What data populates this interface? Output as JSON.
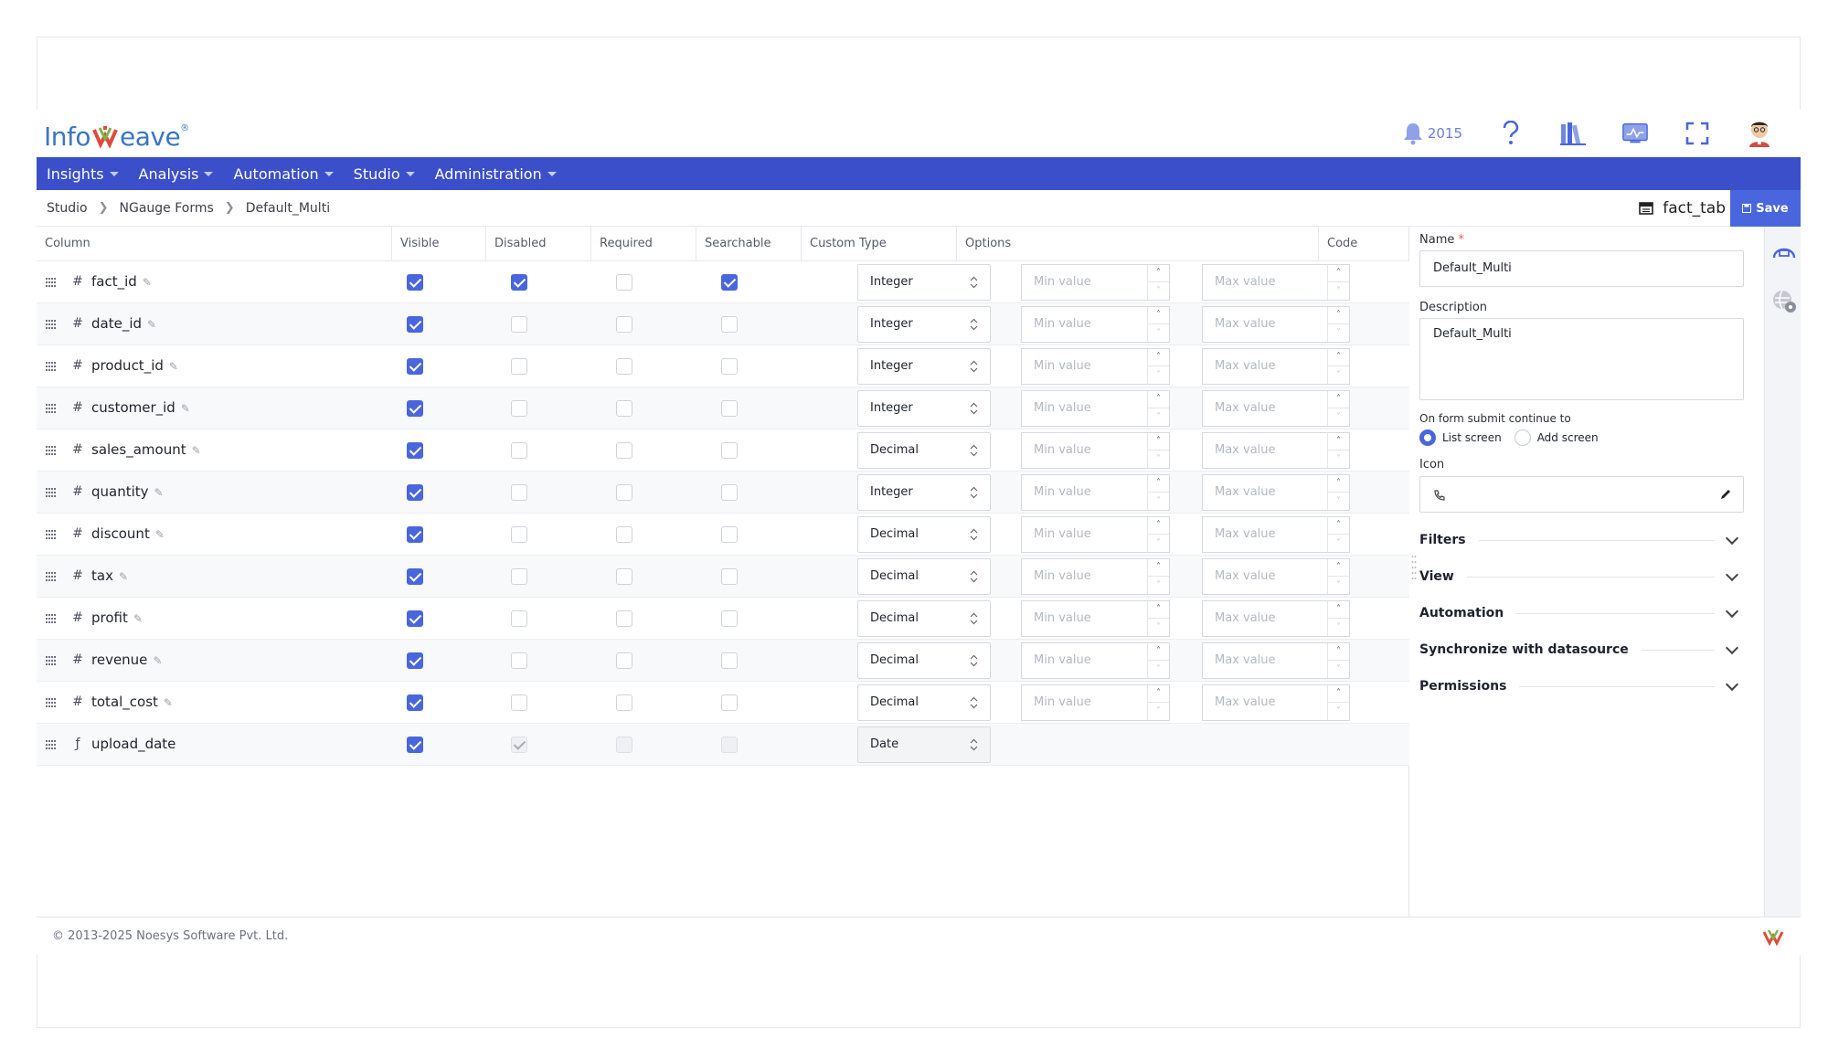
{
  "app": {
    "logo_left": "Info",
    "logo_right": "eave",
    "logo_reg": "®"
  },
  "header": {
    "notification_count": "2015"
  },
  "nav": {
    "items": [
      {
        "label": "Insights"
      },
      {
        "label": "Analysis"
      },
      {
        "label": "Automation"
      },
      {
        "label": "Studio"
      },
      {
        "label": "Administration"
      }
    ]
  },
  "breadcrumb": [
    "Studio",
    "NGauge Forms",
    "Default_Multi"
  ],
  "toolbar": {
    "table_name": "fact_tab",
    "save_label": "Save"
  },
  "grid": {
    "headers": {
      "column": "Column",
      "visible": "Visible",
      "disabled": "Disabled",
      "required": "Required",
      "searchable": "Searchable",
      "custom_type": "Custom Type",
      "options": "Options",
      "code": "Code"
    },
    "min_placeholder": "Min value",
    "max_placeholder": "Max value",
    "rows": [
      {
        "name": "fact_id",
        "type_icon": "hash-icon",
        "visible": true,
        "disabled": true,
        "required": false,
        "searchable": true,
        "custom_type": "Integer",
        "options": true,
        "editable": true,
        "locked": false
      },
      {
        "name": "date_id",
        "type_icon": "hash-icon",
        "visible": true,
        "disabled": false,
        "required": false,
        "searchable": false,
        "custom_type": "Integer",
        "options": true,
        "editable": true,
        "locked": false
      },
      {
        "name": "product_id",
        "type_icon": "hash-icon",
        "visible": true,
        "disabled": false,
        "required": false,
        "searchable": false,
        "custom_type": "Integer",
        "options": true,
        "editable": true,
        "locked": false
      },
      {
        "name": "customer_id",
        "type_icon": "hash-icon",
        "visible": true,
        "disabled": false,
        "required": false,
        "searchable": false,
        "custom_type": "Integer",
        "options": true,
        "editable": true,
        "locked": false
      },
      {
        "name": "sales_amount",
        "type_icon": "hash-icon",
        "visible": true,
        "disabled": false,
        "required": false,
        "searchable": false,
        "custom_type": "Decimal",
        "options": true,
        "editable": true,
        "locked": false
      },
      {
        "name": "quantity",
        "type_icon": "hash-icon",
        "visible": true,
        "disabled": false,
        "required": false,
        "searchable": false,
        "custom_type": "Integer",
        "options": true,
        "editable": true,
        "locked": false
      },
      {
        "name": "discount",
        "type_icon": "hash-icon",
        "visible": true,
        "disabled": false,
        "required": false,
        "searchable": false,
        "custom_type": "Decimal",
        "options": true,
        "editable": true,
        "locked": false
      },
      {
        "name": "tax",
        "type_icon": "hash-icon",
        "visible": true,
        "disabled": false,
        "required": false,
        "searchable": false,
        "custom_type": "Decimal",
        "options": true,
        "editable": true,
        "locked": false
      },
      {
        "name": "profit",
        "type_icon": "hash-icon",
        "visible": true,
        "disabled": false,
        "required": false,
        "searchable": false,
        "custom_type": "Decimal",
        "options": true,
        "editable": true,
        "locked": false
      },
      {
        "name": "revenue",
        "type_icon": "hash-icon",
        "visible": true,
        "disabled": false,
        "required": false,
        "searchable": false,
        "custom_type": "Decimal",
        "options": true,
        "editable": true,
        "locked": false
      },
      {
        "name": "total_cost",
        "type_icon": "hash-icon",
        "visible": true,
        "disabled": false,
        "required": false,
        "searchable": false,
        "custom_type": "Decimal",
        "options": true,
        "editable": true,
        "locked": false
      },
      {
        "name": "upload_date",
        "type_icon": "date-type-icon",
        "visible": true,
        "disabled": true,
        "required": false,
        "searchable": false,
        "custom_type": "Date",
        "options": false,
        "editable": false,
        "locked": true
      }
    ]
  },
  "panel": {
    "name_label": "Name",
    "name_required": "*",
    "name_value": "Default_Multi",
    "description_label": "Description",
    "description_value": "Default_Multi",
    "submit_label": "On form submit continue to",
    "radio_list": "List screen",
    "radio_add": "Add screen",
    "icon_label": "Icon",
    "sections": [
      "Filters",
      "View",
      "Automation",
      "Synchronize with datasource",
      "Permissions"
    ]
  },
  "footer": {
    "copyright": "© 2013-2025 Noesys Software Pvt. Ltd."
  },
  "colors": {
    "brand": "#3b4fcb",
    "accent": "#4a66de",
    "logo": "#3a76c4"
  }
}
